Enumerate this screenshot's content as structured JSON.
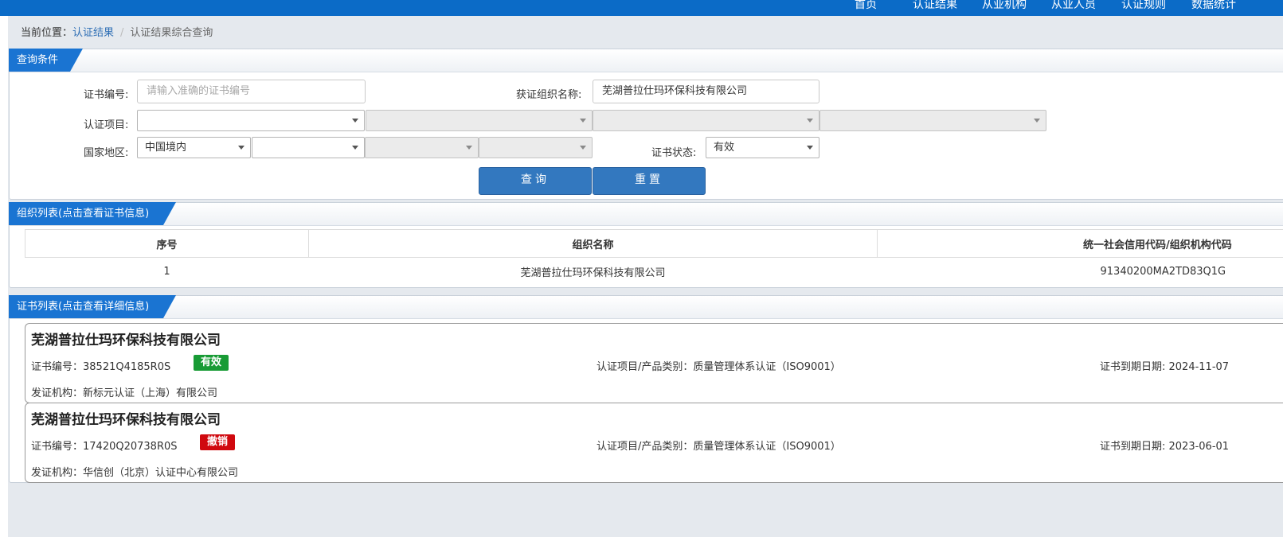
{
  "nav": {
    "items": [
      "首页",
      "认证结果",
      "从业机构",
      "从业人员",
      "认证规则",
      "数据统计"
    ]
  },
  "breadcrumb": {
    "prefix": "当前位置：",
    "link": "认证结果",
    "separator": "/",
    "current": "认证结果综合查询"
  },
  "query": {
    "title": "查询条件",
    "cert_no_label": "证书编号:",
    "cert_no_placeholder": "请输入准确的证书编号",
    "org_name_label": "获证组织名称:",
    "org_name_value": "芜湖普拉仕玛环保科技有限公司",
    "project_label": "认证项目:",
    "project_selects": [
      "",
      "",
      "",
      ""
    ],
    "region_label": "国家地区:",
    "region_selects": [
      "中国境内",
      "",
      "",
      ""
    ],
    "status_label": "证书状态:",
    "status_value": "有效",
    "search_button": "查询",
    "reset_button": "重置"
  },
  "orgs": {
    "title": "组织列表(点击查看证书信息)",
    "columns": [
      "序号",
      "组织名称",
      "统一社会信用代码/组织机构代码"
    ],
    "rows": [
      {
        "index": "1",
        "name": "芜湖普拉仕玛环保科技有限公司",
        "code": "91340200MA2TD83Q1G"
      }
    ]
  },
  "certs": {
    "title": "证书列表(点击查看详细信息)",
    "cert_no_prefix": "证书编号：",
    "issuer_prefix": "发证机构：",
    "items": [
      {
        "org_name": "芜湖普拉仕玛环保科技有限公司",
        "cert_no": "38521Q4185R0S",
        "status": "有效",
        "status_color": "#189b35",
        "project": "认证项目/产品类别：质量管理体系认证（ISO9001）",
        "expiry": "证书到期日期: 2024-11-07",
        "issuer": "新标元认证（上海）有限公司"
      },
      {
        "org_name": "芜湖普拉仕玛环保科技有限公司",
        "cert_no": "17420Q20738R0S",
        "status": "撤销",
        "status_color": "#d0090f",
        "project": "认证项目/产品类别：质量管理体系认证（ISO9001）",
        "expiry": "证书到期日期: 2023-06-01",
        "issuer": "华信创（北京）认证中心有限公司"
      }
    ]
  },
  "colors": {
    "nav_bg": "#0b6bc7",
    "panel_title_bg": "#1a74d2",
    "button_bg": "#3378bf",
    "link": "#2f6fb5"
  }
}
